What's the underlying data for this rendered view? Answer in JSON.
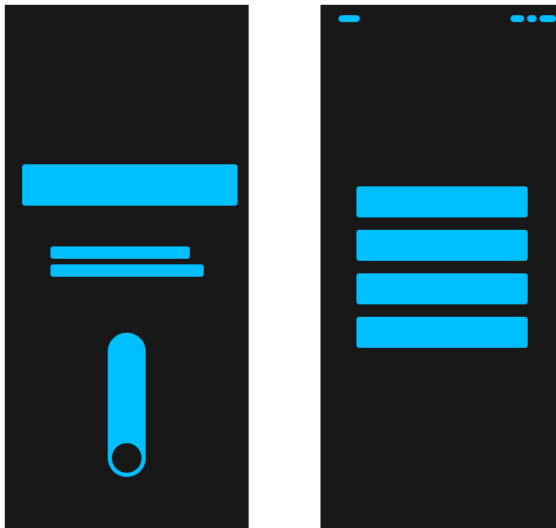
{
  "theme": {
    "background": "#181818",
    "accent": "#00BFFF",
    "page": "#ffffff"
  },
  "left_screen": {
    "title_block": "",
    "lines": [
      "",
      ""
    ],
    "slider": {
      "orientation": "vertical",
      "level": 0
    }
  },
  "right_screen": {
    "status_bar": {
      "left": "",
      "right": [
        "",
        "",
        ""
      ]
    },
    "menu": [
      "",
      "",
      "",
      ""
    ]
  }
}
